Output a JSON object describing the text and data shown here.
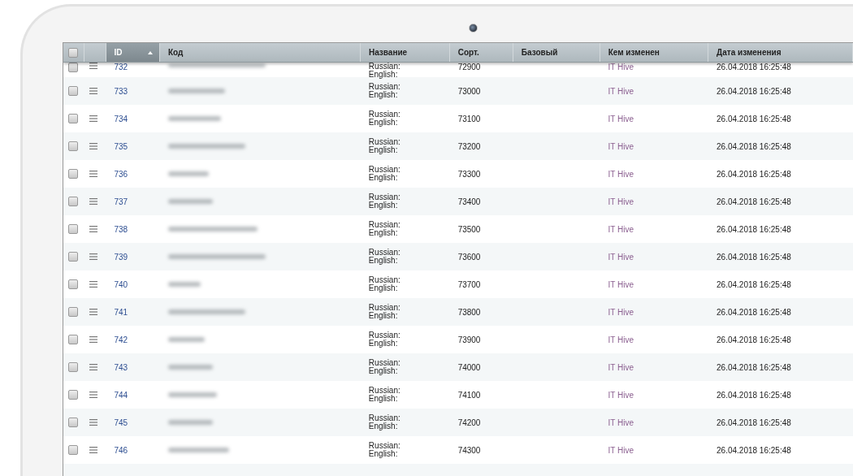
{
  "table": {
    "select_all": {
      "checked": false
    },
    "columns": [
      {
        "label": "ID",
        "sorted": true
      },
      {
        "label": "Код",
        "sorted": false
      },
      {
        "label": "Название",
        "sorted": false
      },
      {
        "label": "Сорт.",
        "sorted": false
      },
      {
        "label": "Базовый",
        "sorted": false
      },
      {
        "label": "Кем изменен",
        "sorted": false
      },
      {
        "label": "Дата изменения",
        "sorted": false
      }
    ],
    "rows": [
      {
        "id": "732",
        "checked": false,
        "name_lines": [
          "Russian:",
          "English:"
        ],
        "sort": "72900",
        "modified_by": "IT Hive",
        "modified_at": "26.04.2018 16:25:48"
      },
      {
        "id": "733",
        "checked": false,
        "name_lines": [
          "Russian:",
          "English:"
        ],
        "sort": "73000",
        "modified_by": "IT Hive",
        "modified_at": "26.04.2018 16:25:48"
      },
      {
        "id": "734",
        "checked": false,
        "name_lines": [
          "Russian:",
          "English:"
        ],
        "sort": "73100",
        "modified_by": "IT Hive",
        "modified_at": "26.04.2018 16:25:48"
      },
      {
        "id": "735",
        "checked": false,
        "name_lines": [
          "Russian:",
          "English:"
        ],
        "sort": "73200",
        "modified_by": "IT Hive",
        "modified_at": "26.04.2018 16:25:48"
      },
      {
        "id": "736",
        "checked": false,
        "name_lines": [
          "Russian:",
          "English:"
        ],
        "sort": "73300",
        "modified_by": "IT Hive",
        "modified_at": "26.04.2018 16:25:48"
      },
      {
        "id": "737",
        "checked": false,
        "name_lines": [
          "Russian:",
          "English:"
        ],
        "sort": "73400",
        "modified_by": "IT Hive",
        "modified_at": "26.04.2018 16:25:48"
      },
      {
        "id": "738",
        "checked": false,
        "name_lines": [
          "Russian:",
          "English:"
        ],
        "sort": "73500",
        "modified_by": "IT Hive",
        "modified_at": "26.04.2018 16:25:48"
      },
      {
        "id": "739",
        "checked": false,
        "name_lines": [
          "Russian:",
          "English:"
        ],
        "sort": "73600",
        "modified_by": "IT Hive",
        "modified_at": "26.04.2018 16:25:48"
      },
      {
        "id": "740",
        "checked": false,
        "name_lines": [
          "Russian:",
          "English:"
        ],
        "sort": "73700",
        "modified_by": "IT Hive",
        "modified_at": "26.04.2018 16:25:48"
      },
      {
        "id": "741",
        "checked": false,
        "name_lines": [
          "Russian:",
          "English:"
        ],
        "sort": "73800",
        "modified_by": "IT Hive",
        "modified_at": "26.04.2018 16:25:48"
      },
      {
        "id": "742",
        "checked": false,
        "name_lines": [
          "Russian:",
          "English:"
        ],
        "sort": "73900",
        "modified_by": "IT Hive",
        "modified_at": "26.04.2018 16:25:48"
      },
      {
        "id": "743",
        "checked": false,
        "name_lines": [
          "Russian:",
          "English:"
        ],
        "sort": "74000",
        "modified_by": "IT Hive",
        "modified_at": "26.04.2018 16:25:48"
      },
      {
        "id": "744",
        "checked": false,
        "name_lines": [
          "Russian:",
          "English:"
        ],
        "sort": "74100",
        "modified_by": "IT Hive",
        "modified_at": "26.04.2018 16:25:48"
      },
      {
        "id": "745",
        "checked": false,
        "name_lines": [
          "Russian:",
          "English:"
        ],
        "sort": "74200",
        "modified_by": "IT Hive",
        "modified_at": "26.04.2018 16:25:48"
      },
      {
        "id": "746",
        "checked": false,
        "name_lines": [
          "Russian:",
          "English:"
        ],
        "sort": "74300",
        "modified_by": "IT Hive",
        "modified_at": "26.04.2018 16:25:48"
      }
    ]
  }
}
